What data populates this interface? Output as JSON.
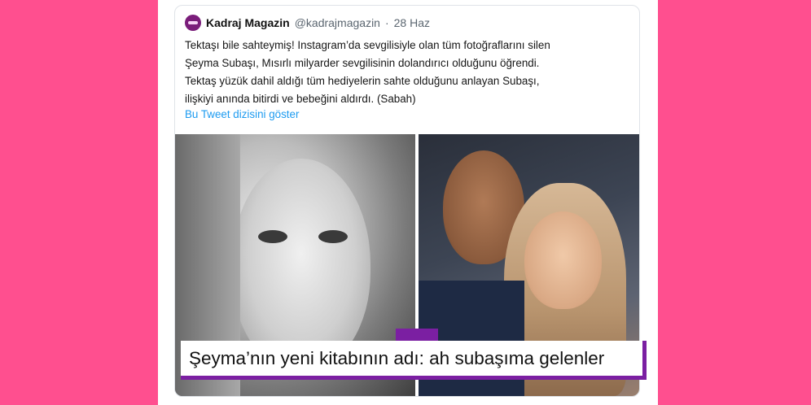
{
  "tweet": {
    "author_name": "Kadraj Magazin",
    "handle": "@kadrajmagazin",
    "separator": "·",
    "date": "28 Haz",
    "text_lines": [
      "Tektaşı bile sahteymiş! Instagram’da sevgilisiyle olan tüm fotoğraflarını silen",
      "Şeyma Subaşı, Mısırlı milyarder sevgilisinin dolandırıcı olduğunu öğrendi.",
      "Tektaş yüzük dahil aldığı tüm hediyelerin sahte olduğunu anlayan Subaşı,",
      "ilişkiyi anında bitirdi ve bebeğini aldırdı. (Sabah)"
    ],
    "thread_link": "Bu Tweet dizisini göster"
  },
  "caption": {
    "text": "Şeyma’nın yeni kitabının adı: ah subaşıma gelenler"
  },
  "colors": {
    "background": "#ff4f8f",
    "accent": "#7b1fa2",
    "link": "#1d9bf0"
  }
}
